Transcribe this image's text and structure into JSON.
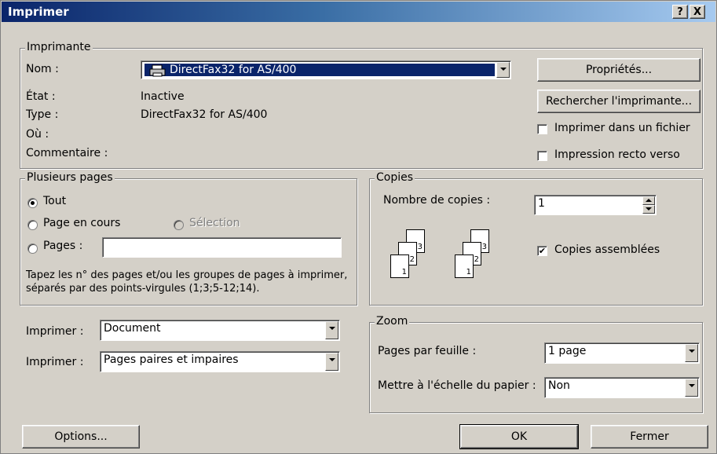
{
  "window": {
    "title": "Imprimer",
    "help_btn": "?",
    "close_btn": "X"
  },
  "printer": {
    "legend": "Imprimante",
    "name_label": "Nom :",
    "name_value": "DirectFax32 for AS/400",
    "status_label": "État :",
    "status_value": "Inactive",
    "type_label": "Type :",
    "type_value": "DirectFax32 for AS/400",
    "where_label": "Où :",
    "where_value": "",
    "comment_label": "Commentaire :",
    "comment_value": "",
    "properties_btn": "Propriétés...",
    "find_btn": "Rechercher l'imprimante...",
    "print_to_file_label": "Imprimer dans un fichier",
    "print_to_file_checked": false,
    "duplex_label": "Impression recto verso",
    "duplex_checked": false
  },
  "pages": {
    "legend": "Plusieurs pages",
    "all_label": "Tout",
    "current_label": "Page en cours",
    "selection_label": "Sélection",
    "pages_label": "Pages :",
    "pages_value": "",
    "selected": "all",
    "hint": "Tapez les n° des pages et/ou les groupes de pages à imprimer, séparés par des points-virgules (1;3;5-12;14)."
  },
  "copies": {
    "legend": "Copies",
    "count_label": "Nombre de copies :",
    "count_value": "1",
    "collate_label": "Copies assemblées",
    "collate_checked": true,
    "page_numbers": [
      "3",
      "2",
      "1"
    ]
  },
  "print_what": {
    "label": "Imprimer :",
    "value": "Document"
  },
  "print_range": {
    "label": "Imprimer :",
    "value": "Pages paires et impaires"
  },
  "zoom": {
    "legend": "Zoom",
    "pages_per_sheet_label": "Pages par feuille :",
    "pages_per_sheet_value": "1 page",
    "scale_label": "Mettre à l'échelle du papier :",
    "scale_value": "Non"
  },
  "footer": {
    "options_btn": "Options...",
    "ok_btn": "OK",
    "close_btn": "Fermer"
  },
  "colors": {
    "titlebar_start": "#0a246a",
    "titlebar_end": "#a6caf0",
    "face": "#d4d0c8",
    "selection": "#0a246a"
  },
  "icons": {
    "printer": "printer-icon"
  }
}
